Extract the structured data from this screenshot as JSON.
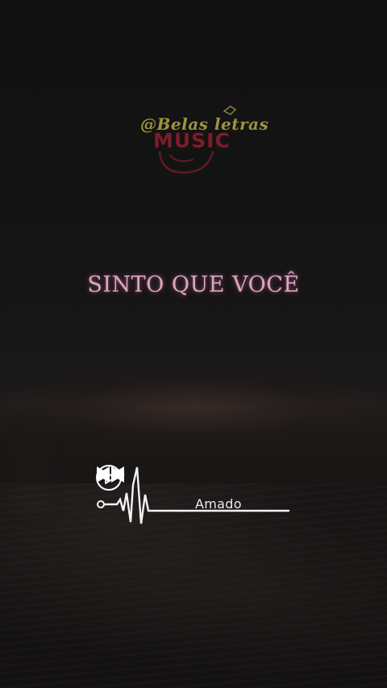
{
  "watermark": {
    "handle": "@Belas letras",
    "word": "MUSIC"
  },
  "lyric": {
    "text": "SINTO QUE VOCÊ"
  },
  "player": {
    "song_title": "Amado",
    "icons": {
      "waveform": "heartbeat-wave-icon",
      "previous": "rewind-icon",
      "play": "play-circle-icon",
      "next": "fast-forward-icon"
    }
  },
  "colors": {
    "lyric": "#d9a6c0",
    "logo_handle": "#9a9440",
    "logo_word": "#7b1f2a",
    "player": "#ffffff"
  }
}
